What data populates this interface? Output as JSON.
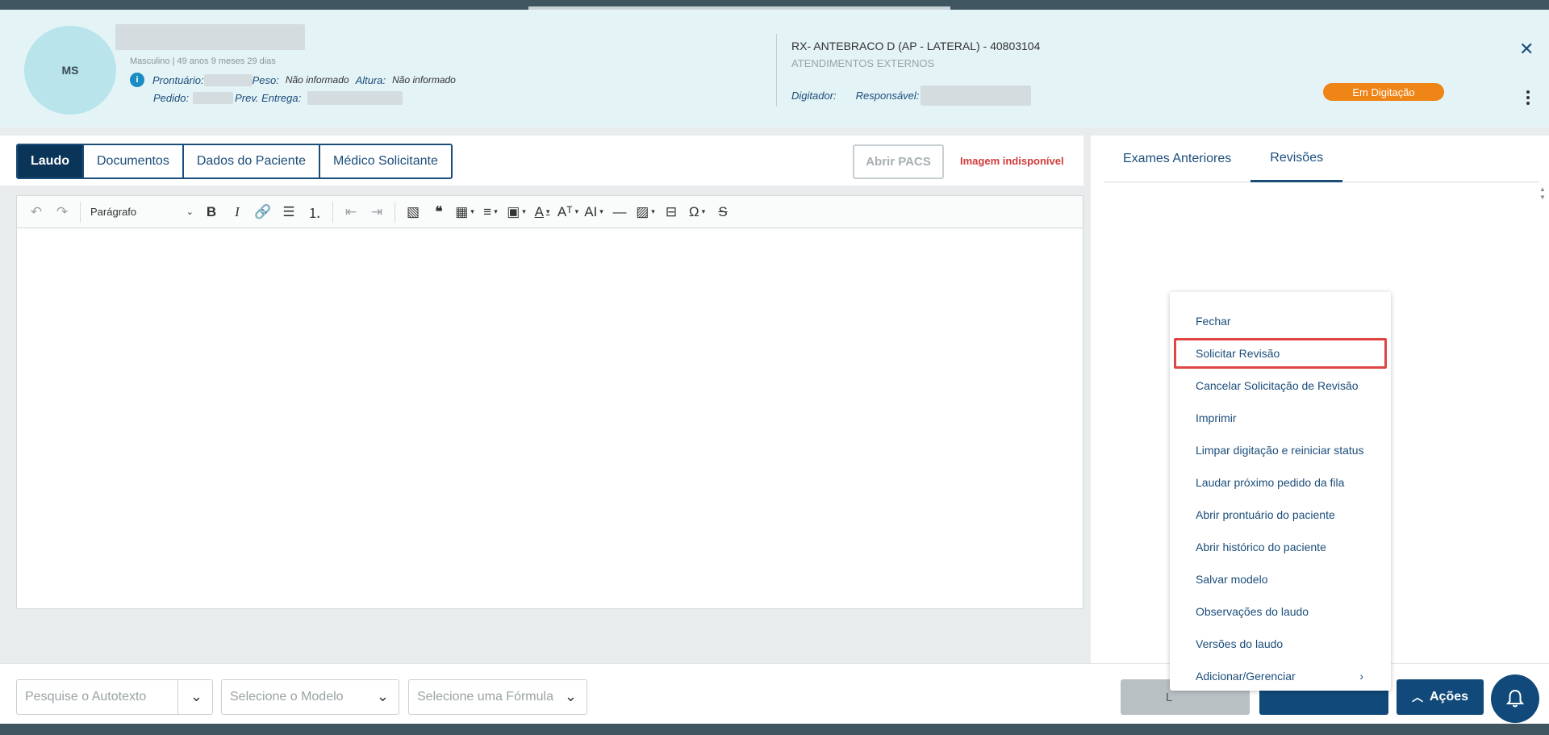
{
  "patient": {
    "initials": "MS",
    "info": "Masculino | 49 anos 9 meses 29 dias",
    "prontuario_label": "Prontuário:",
    "peso_label": "Peso:",
    "peso_value": "Não informado",
    "altura_label": "Altura:",
    "altura_value": "Não informado",
    "pedido_label": "Pedido:",
    "prev_entrega_label": "Prev. Entrega:",
    "info_icon": "i"
  },
  "exam": {
    "title": "RX- ANTEBRACO D (AP - LATERAL) - 40803104",
    "subtitle": "ATENDIMENTOS EXTERNOS",
    "digitador_label": "Digitador:",
    "responsavel_label": "Responsável:",
    "status": "Em Digitação",
    "status_color": "#ef8417"
  },
  "tabs": [
    "Laudo",
    "Documentos",
    "Dados do Paciente",
    "Médico Solicitante"
  ],
  "pacs_button": "Abrir PACS",
  "image_unavailable": "Imagem indisponível",
  "toolbar": {
    "paragraph_select": "Parágrafo"
  },
  "right_tabs": [
    "Exames Anteriores",
    "Revisões"
  ],
  "menu": {
    "items": [
      "Fechar",
      "Solicitar Revisão",
      "Cancelar Solicitação de Revisão",
      "Imprimir",
      "Limpar digitação e reiniciar status",
      "Laudar próximo pedido da fila",
      "Abrir prontuário do paciente",
      "Abrir histórico do paciente",
      "Salvar modelo",
      "Observações do laudo",
      "Versões do laudo",
      "Adicionar/Gerenciar"
    ],
    "highlighted": "Solicitar Revisão"
  },
  "bottom": {
    "autotexto_placeholder": "Pesquise o Autotexto",
    "modelo_placeholder": "Selecione o Modelo",
    "formula_placeholder": "Selecione uma Fórmula",
    "grey_button_partial": "L",
    "acoes_label": "Ações"
  },
  "colors": {
    "primary": "#10497a",
    "header_bg": "#e4f3f6",
    "highlight": "#e04545"
  }
}
